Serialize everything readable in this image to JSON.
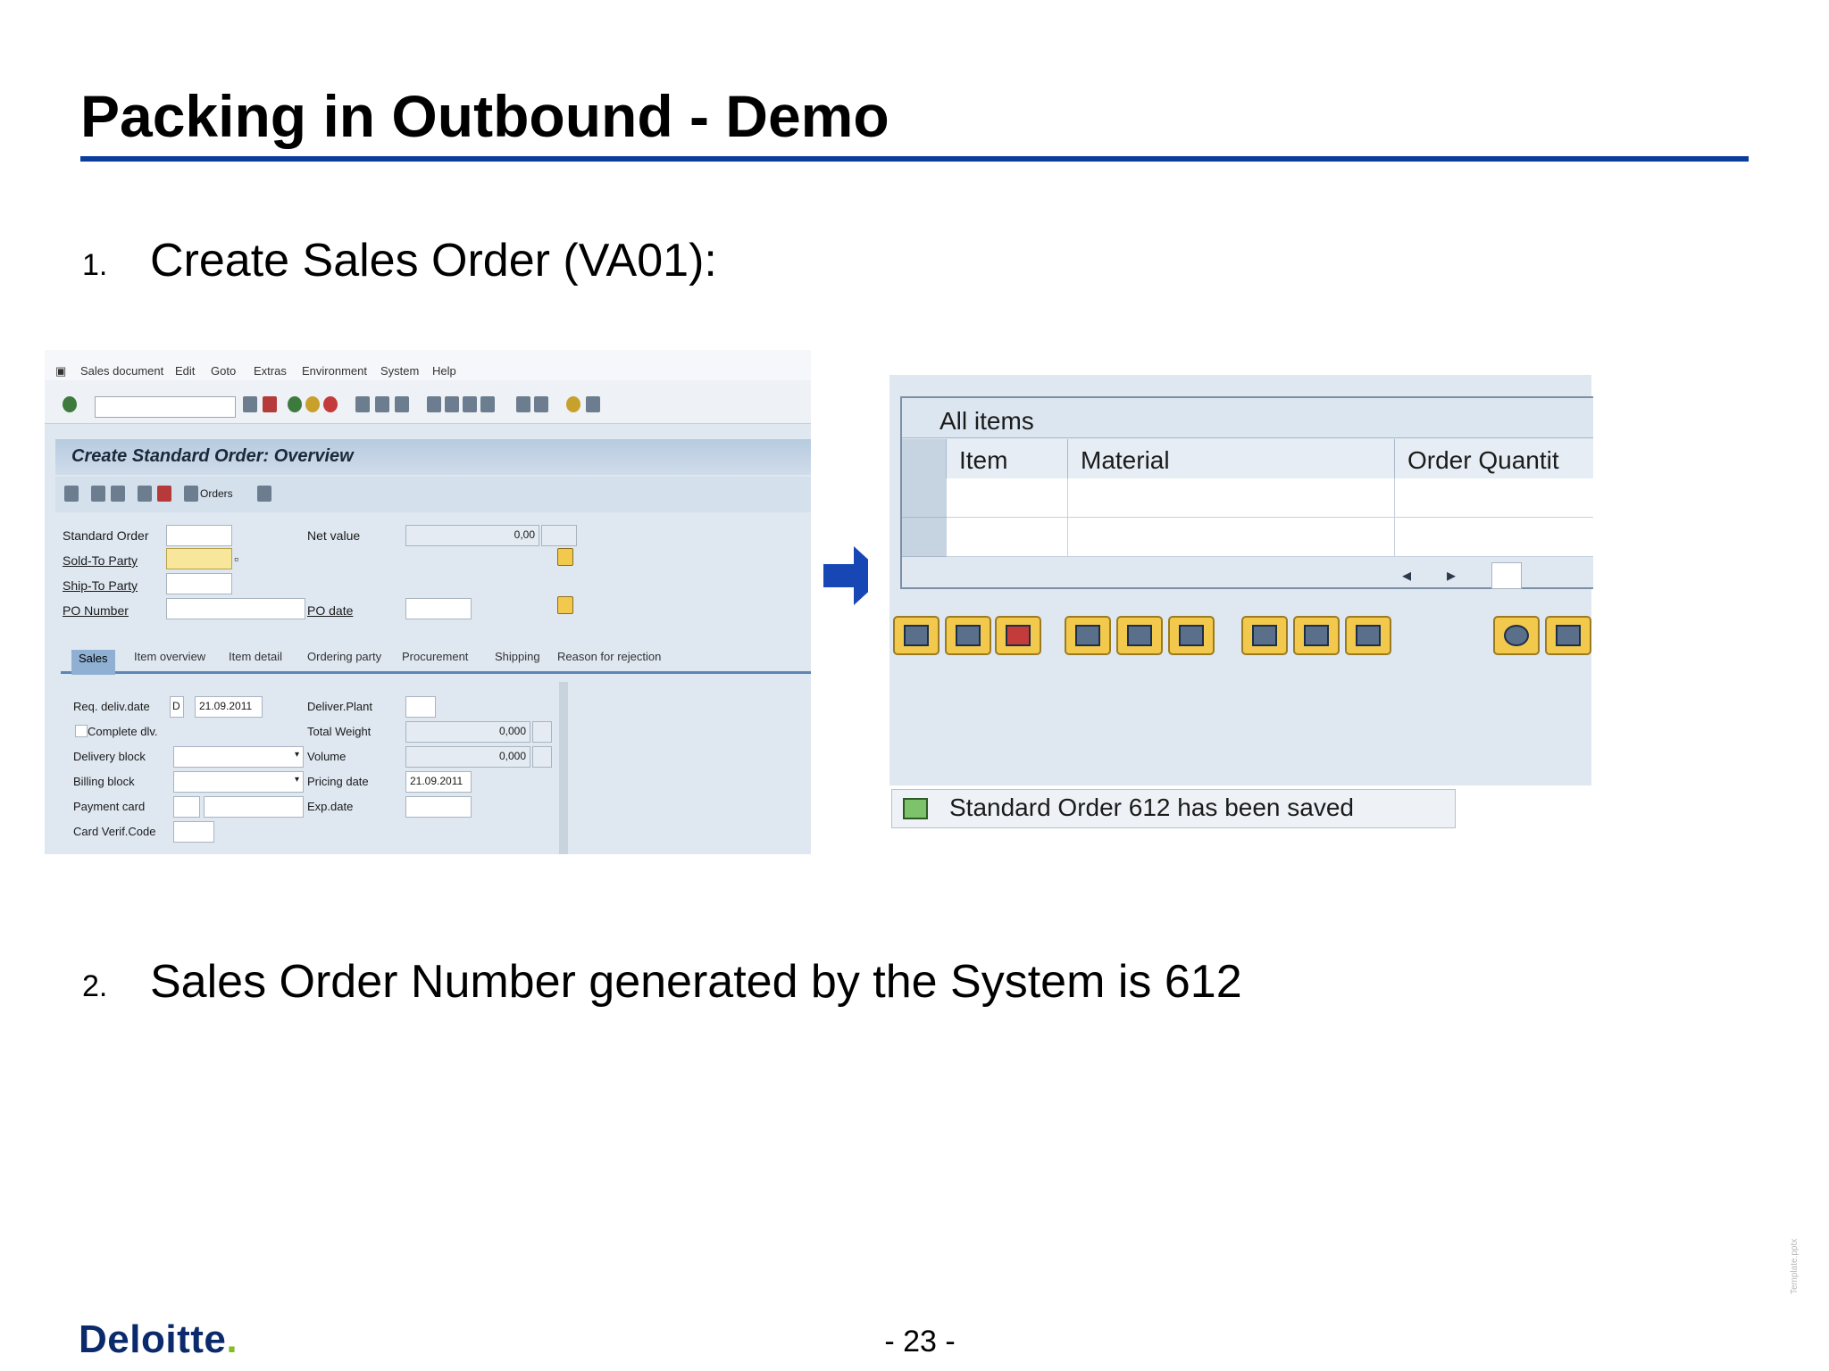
{
  "slide": {
    "title": "Packing in Outbound - Demo",
    "steps": [
      {
        "num": "1.",
        "text": "Create Sales Order (VA01):"
      },
      {
        "num": "2.",
        "text": "Sales Order Number generated by the System is 612"
      }
    ],
    "page_number": "- 23 -",
    "logo": "Deloitte",
    "template_mark": "Template.pptx",
    "accent_color": "#0a3d9c"
  },
  "left_screen": {
    "menu": [
      "Sales document",
      "Edit",
      "Goto",
      "Extras",
      "Environment",
      "System",
      "Help"
    ],
    "screen_title": "Create Standard Order: Overview",
    "orders_button": "Orders",
    "fields": {
      "standard_order": "Standard Order",
      "net_value": "Net value",
      "net_value_val": "0,00",
      "sold_to": "Sold-To Party",
      "ship_to": "Ship-To Party",
      "po_number": "PO Number",
      "po_date": "PO date"
    },
    "tabs": [
      "Sales",
      "Item overview",
      "Item detail",
      "Ordering party",
      "Procurement",
      "Shipping",
      "Reason for rejection"
    ],
    "sales_tab": {
      "req_deliv_date": "Req. deliv.date",
      "req_deliv_unit": "D",
      "req_deliv_val": "21.09.2011",
      "deliver_plant": "Deliver.Plant",
      "complete_dlv": "Complete dlv.",
      "total_weight": "Total Weight",
      "total_weight_val": "0,000",
      "delivery_block": "Delivery block",
      "volume": "Volume",
      "volume_val": "0,000",
      "billing_block": "Billing block",
      "pricing_date": "Pricing date",
      "pricing_date_val": "21.09.2011",
      "payment_card": "Payment card",
      "exp_date": "Exp.date",
      "card_verif": "Card Verif.Code"
    }
  },
  "right_screen": {
    "grid_label": "All items",
    "columns": [
      "Item",
      "Material",
      "Order Quantit"
    ],
    "status_message": "Standard Order 612 has been saved"
  }
}
